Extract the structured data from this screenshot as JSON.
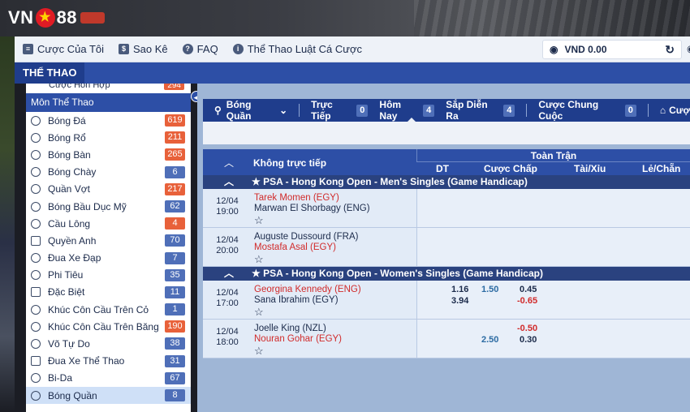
{
  "brand": {
    "logo_text_left": "VN",
    "logo_text_right": "88"
  },
  "nav": {
    "items": [
      {
        "label": "Cược Của Tôi",
        "icon": "receipt-icon"
      },
      {
        "label": "Sao Kê",
        "icon": "statement-icon"
      },
      {
        "label": "FAQ",
        "icon": "question-icon"
      },
      {
        "label": "Thể Thao Luật Cá Cược",
        "icon": "info-icon"
      }
    ],
    "balance": "VND 0.00"
  },
  "section_title": "THỂ THAO",
  "sidebar": {
    "top_item": {
      "label": "Cược Hỗn Hợp",
      "count": "294"
    },
    "header": "Môn Thể Thao",
    "items": [
      {
        "label": "Bóng Đá",
        "count": "619",
        "hot": true
      },
      {
        "label": "Bóng Rổ",
        "count": "211",
        "hot": true
      },
      {
        "label": "Bóng Bàn",
        "count": "265",
        "hot": true
      },
      {
        "label": "Bóng Chày",
        "count": "6",
        "hot": false
      },
      {
        "label": "Quần Vợt",
        "count": "217",
        "hot": true
      },
      {
        "label": "Bóng Bầu Dục Mỹ",
        "count": "62",
        "hot": false
      },
      {
        "label": "Cầu Lông",
        "count": "4",
        "hot": true
      },
      {
        "label": "Quyền Anh",
        "count": "70",
        "hot": false
      },
      {
        "label": "Đua Xe Đạp",
        "count": "7",
        "hot": false
      },
      {
        "label": "Phi Tiêu",
        "count": "35",
        "hot": false
      },
      {
        "label": "Đặc Biệt",
        "count": "11",
        "hot": false
      },
      {
        "label": "Khúc Côn Cầu Trên Cỏ",
        "count": "1",
        "hot": false
      },
      {
        "label": "Khúc Côn Cầu Trên Băng",
        "count": "190",
        "hot": true
      },
      {
        "label": "Võ Tự Do",
        "count": "38",
        "hot": false
      },
      {
        "label": "Đua Xe Thể Thao",
        "count": "31",
        "hot": false
      },
      {
        "label": "Bi-Da",
        "count": "67",
        "hot": false
      },
      {
        "label": "Bóng Quần",
        "count": "8",
        "hot": false,
        "active": true
      }
    ]
  },
  "tabs": {
    "sport": "Bóng Quần",
    "live": {
      "label": "Trực Tiếp",
      "count": "0"
    },
    "today": {
      "label": "Hôm Nay",
      "count": "4"
    },
    "upcoming": {
      "label": "Sắp Diễn Ra",
      "count": "4"
    },
    "outright": {
      "label": "Cược Chung Cuộc",
      "count": "0"
    },
    "more": "Cượ"
  },
  "table": {
    "not_live": "Không trực tiếp",
    "full_match": "Toàn Trận",
    "cols": {
      "dt": "DT",
      "handicap": "Cược Chấp",
      "ou": "Tài/Xỉu",
      "oe": "Lẻ/Chẵn"
    },
    "leagues": [
      {
        "name": "PSA - Hong Kong Open - Men's Singles (Game Handicap)",
        "matches": [
          {
            "date": "12/04",
            "time": "19:00",
            "home": "Tarek Momen (EGY)",
            "away": "Marwan El Shorbagy (ENG)"
          },
          {
            "date": "12/04",
            "time": "20:00",
            "home": "Auguste Dussourd (FRA)",
            "away": "Mostafa Asal (EGY)"
          }
        ]
      },
      {
        "name": "PSA - Hong Kong Open - Women's Singles (Game Handicap)",
        "matches": [
          {
            "date": "12/04",
            "time": "17:00",
            "home": "Georgina Kennedy (ENG)",
            "away": "Sana Ibrahim (EGY)",
            "dt1": "1.16",
            "dt2": "3.94",
            "hcap_line": "1.50",
            "hcap1": "0.45",
            "hcap2": "-0.65"
          },
          {
            "date": "12/04",
            "time": "18:00",
            "home": "Joelle King (NZL)",
            "away": "Nouran Gohar (EGY)",
            "hcap_line": "2.50",
            "hcap1": "-0.50",
            "hcap2": "0.30"
          }
        ]
      }
    ]
  }
}
